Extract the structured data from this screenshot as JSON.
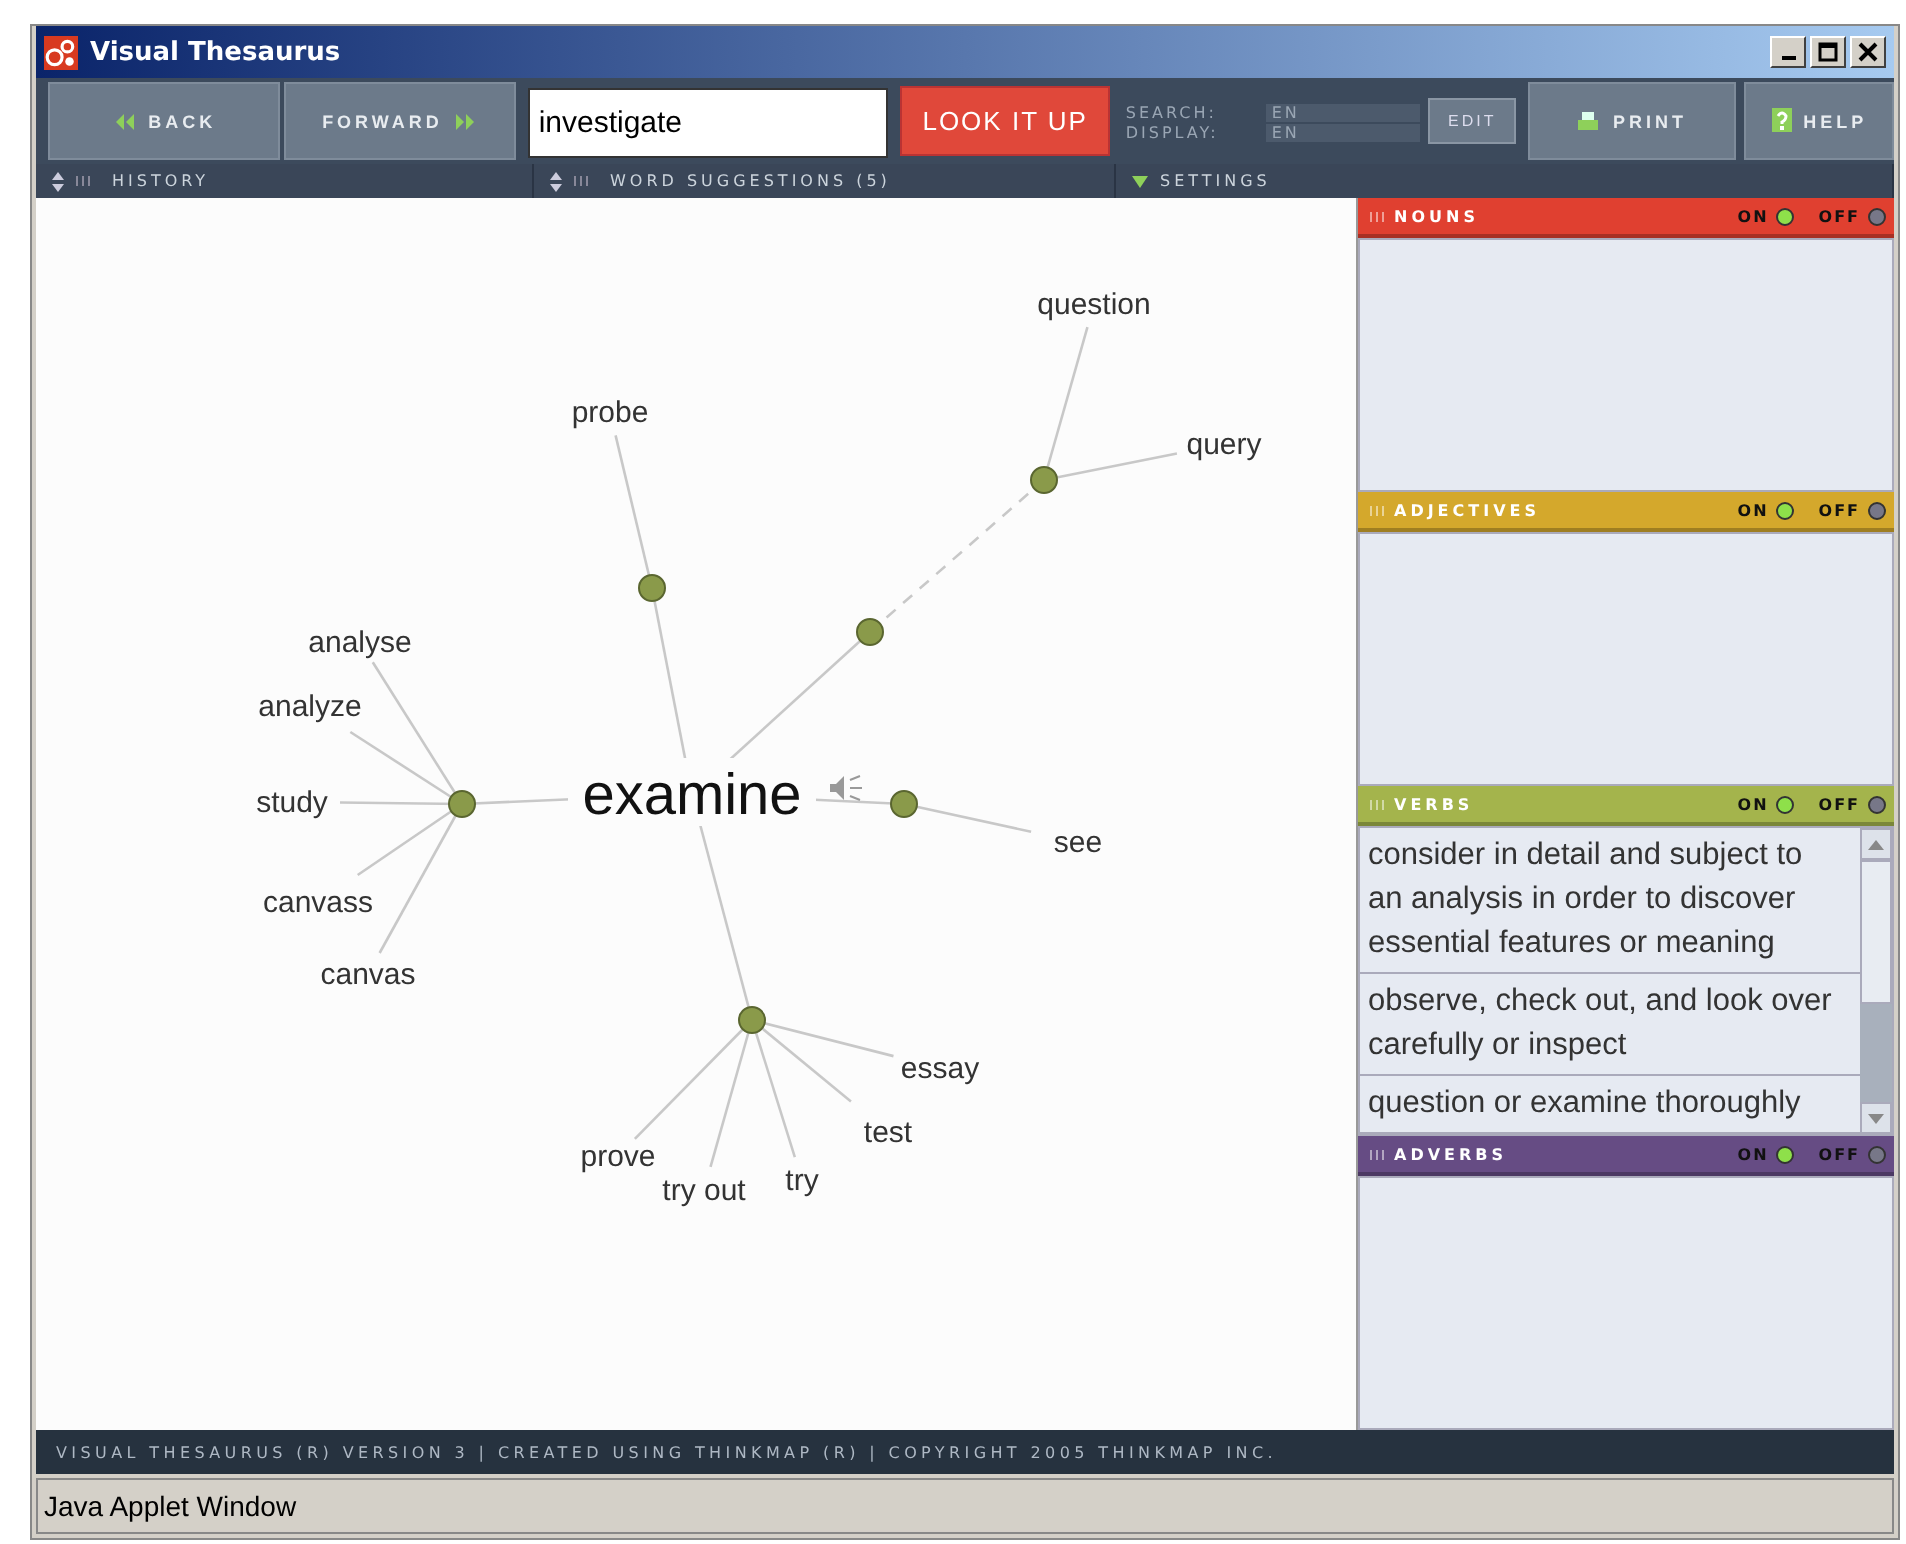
{
  "window": {
    "title": "Visual Thesaurus"
  },
  "toolbar": {
    "back": "BACK",
    "forward": "FORWARD",
    "search": {
      "value": "investigate"
    },
    "lookup": "LOOK IT UP",
    "search_lang_label": "SEARCH:",
    "search_lang": "EN",
    "display_lang_label": "DISPLAY:",
    "display_lang": "EN",
    "edit": "EDIT",
    "print": "PRINT",
    "help": "HELP"
  },
  "subbar": [
    {
      "label": "HISTORY",
      "kind": "updown"
    },
    {
      "label": "WORD SUGGESTIONS (5)",
      "kind": "updown"
    },
    {
      "label": "SETTINGS",
      "kind": "dropdown"
    }
  ],
  "graph": {
    "center": "examine",
    "meanings": [
      {
        "words": [
          "probe"
        ]
      },
      {
        "linked": [
          {
            "words": [
              "question",
              "query"
            ]
          }
        ]
      },
      {
        "words": [
          "see"
        ]
      },
      {
        "words": [
          "analyse",
          "analyze",
          "study",
          "canvass",
          "canvas"
        ]
      },
      {
        "words": [
          "prove",
          "try out",
          "try",
          "test",
          "essay"
        ]
      }
    ]
  },
  "panels": [
    {
      "title": "NOUNS",
      "color": "#e04030",
      "on_label": "ON",
      "off_label": "OFF",
      "on": true
    },
    {
      "title": "ADJECTIVES",
      "color": "#d4a82c",
      "on_label": "ON",
      "off_label": "OFF",
      "on": true
    },
    {
      "title": "VERBS",
      "color": "#a4b44c",
      "on_label": "ON",
      "off_label": "OFF",
      "on": true,
      "definitions": [
        "consider in detail and subject to an analysis in order to discover essential features or meaning",
        "observe, check out, and look over carefully or inspect",
        "question or examine thoroughly"
      ]
    },
    {
      "title": "ADVERBS",
      "color": "#664c84",
      "on_label": "ON",
      "off_label": "OFF",
      "on": true
    }
  ],
  "footer": "VISUAL THESAURUS (R) VERSION 3 | CREATED USING THINKMAP (R) | COPYRIGHT 2005 THINKMAP INC.",
  "status_bar": "Java Applet Window"
}
